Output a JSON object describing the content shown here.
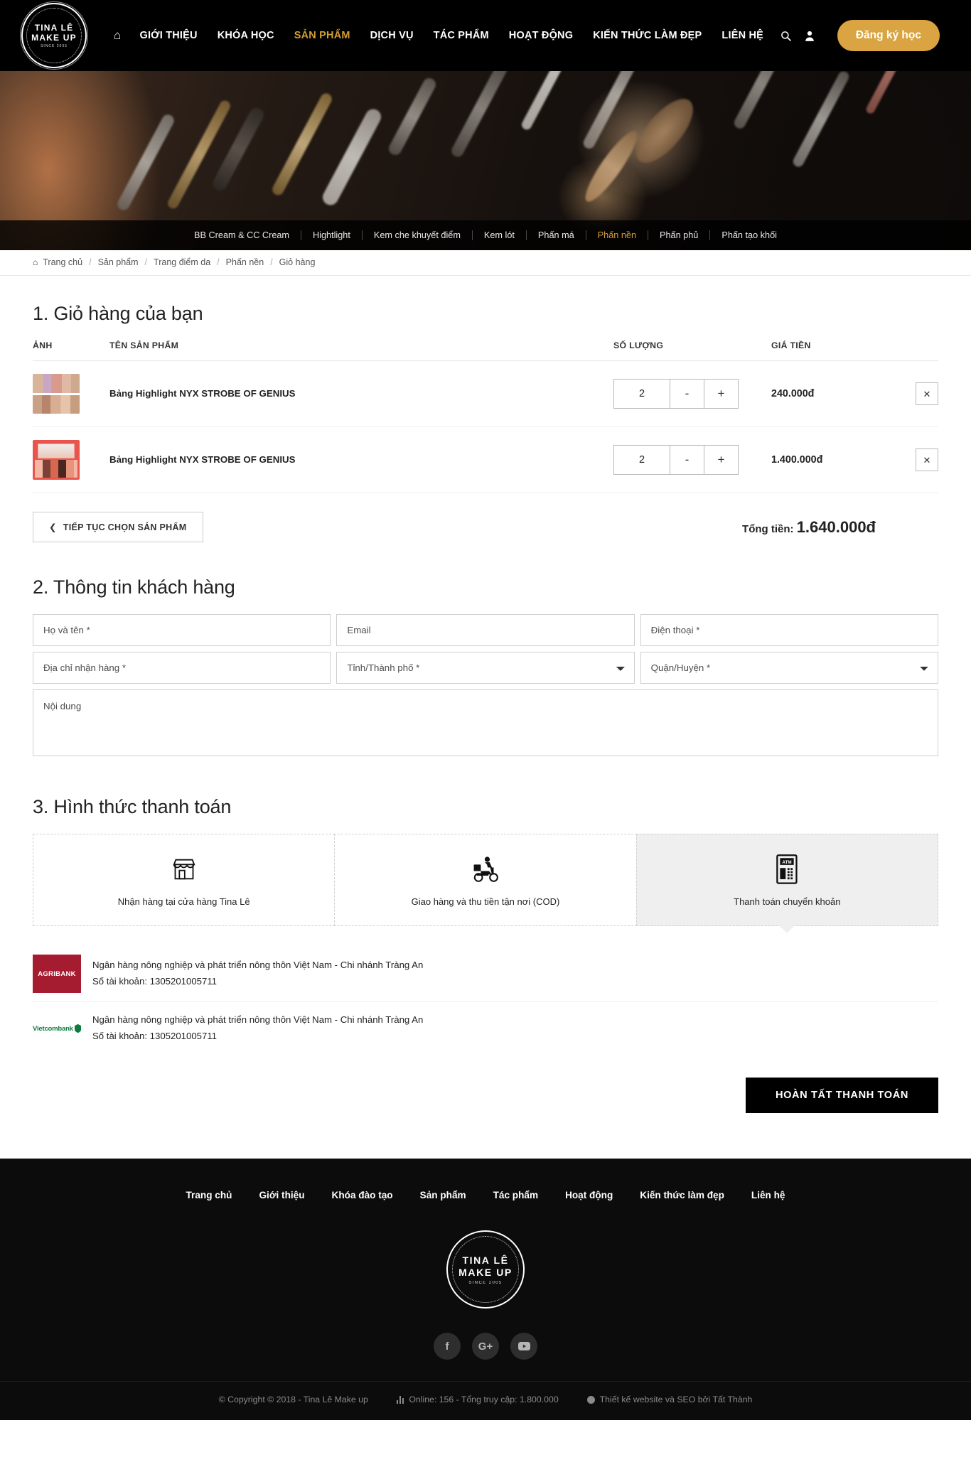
{
  "header": {
    "logo": {
      "line1": "TINA LÊ",
      "line2": "MAKE UP",
      "line3": "SINCE 2005"
    },
    "home_icon": "home-icon",
    "nav": [
      {
        "label": "GIỚI THIỆU",
        "active": false
      },
      {
        "label": "KHÓA HỌC",
        "active": false
      },
      {
        "label": "SẢN PHẨM",
        "active": true
      },
      {
        "label": "DỊCH VỤ",
        "active": false
      },
      {
        "label": "TÁC PHẨM",
        "active": false
      },
      {
        "label": "HOẠT ĐỘNG",
        "active": false
      },
      {
        "label": "KIẾN THỨC LÀM ĐẸP",
        "active": false
      },
      {
        "label": "LIÊN HỆ",
        "active": false
      }
    ],
    "search_icon": "search-icon",
    "account_icon": "user-icon",
    "cta_label": "Đăng ký học",
    "cta_color": "#d9a441"
  },
  "subnav": [
    {
      "label": "BB Cream & CC Cream",
      "active": false
    },
    {
      "label": "Hightlight",
      "active": false
    },
    {
      "label": "Kem che khuyết điểm",
      "active": false
    },
    {
      "label": "Kem lót",
      "active": false
    },
    {
      "label": "Phấn má",
      "active": false
    },
    {
      "label": "Phấn nền",
      "active": true
    },
    {
      "label": "Phấn phủ",
      "active": false
    },
    {
      "label": "Phấn tạo khối",
      "active": false
    }
  ],
  "breadcrumb": {
    "home_icon": "home-icon",
    "items": [
      "Trang chủ",
      "Sản phẩm",
      "Trang điểm da",
      "Phấn nền",
      "Giỏ hàng"
    ],
    "separator": "/"
  },
  "cart": {
    "title": "1. Giỏ hàng của bạn",
    "columns": [
      "ẢNH",
      "TÊN SẢN PHẨM",
      "SỐ LƯỢNG",
      "GIÁ TIỀN"
    ],
    "rows": [
      {
        "name": "Bảng Highlight NYX STROBE OF GENIUS",
        "qty": "2",
        "minus": "-",
        "plus": "+",
        "price": "240.000đ",
        "remove": "✕"
      },
      {
        "name": "Bảng Highlight NYX STROBE OF GENIUS",
        "qty": "2",
        "minus": "-",
        "plus": "+",
        "price": "1.400.000đ",
        "remove": "✕"
      }
    ],
    "continue_label": "TIẾP TỤC CHỌN SẢN PHẨM",
    "continue_icon": "chevron-left-icon",
    "total_label": "Tổng tiền:",
    "total_value": "1.640.000đ"
  },
  "customer": {
    "title": "2. Thông tin khách hàng",
    "fields": {
      "fullname_placeholder": "Họ và tên *",
      "email_placeholder": "Email",
      "phone_placeholder": "Điện thoại *",
      "address_placeholder": "Địa chỉ nhận hàng *",
      "province_placeholder": "Tỉnh/Thành phố  *",
      "district_placeholder": "Quận/Huyện  *",
      "note_placeholder": "Nội dung"
    },
    "values": {
      "fullname": "",
      "email": "",
      "phone": "",
      "address": "",
      "province": "",
      "district": "",
      "note": ""
    }
  },
  "payment": {
    "title": "3. Hình thức thanh toán",
    "methods": [
      {
        "label": "Nhận hàng tại cửa hàng Tina Lê",
        "icon": "store-icon",
        "selected": false
      },
      {
        "label": "Giao hàng và thu tiền tận nơi (COD)",
        "icon": "scooter-delivery-icon",
        "selected": false
      },
      {
        "label": "Thanh toán chuyển khoản",
        "icon": "atm-icon",
        "selected": true
      }
    ],
    "banks": [
      {
        "logo_text": "AGRIBANK",
        "logo_color": "#a51c30",
        "name": "Ngân hàng nông nghiệp và phát triển nông thôn Việt Nam - Chi nhánh Tràng An",
        "account": "Số tài khoản: 1305201005711"
      },
      {
        "logo_text": "Vietcombank",
        "logo_color": "#0c7c3e",
        "name": "Ngân hàng nông nghiệp và phát triển nông thôn Việt Nam - Chi nhánh Tràng An",
        "account": "Số tài khoản: 1305201005711"
      }
    ],
    "submit_label": "HOÀN TẤT THANH TOÁN"
  },
  "footer": {
    "nav": [
      "Trang chủ",
      "Giới thiệu",
      "Khóa đào tạo",
      "Sản phẩm",
      "Tác phẩm",
      "Hoạt động",
      "Kiến thức làm đẹp",
      "Liên hệ"
    ],
    "logo": {
      "line1": "TINA LÊ",
      "line2": "MAKE UP",
      "line3": "SINCE 2005"
    },
    "social": [
      {
        "name": "facebook-icon",
        "glyph": "f"
      },
      {
        "name": "google-plus-icon",
        "glyph": "G+"
      },
      {
        "name": "youtube-icon",
        "glyph": "▶"
      }
    ],
    "copyright": "© Copyright © 2018 - Tina Lê Make up",
    "stats": "Online: 156  - Tổng truy cập: 1.800.000",
    "credit": "Thiết kế website và SEO bởi Tất Thành"
  }
}
